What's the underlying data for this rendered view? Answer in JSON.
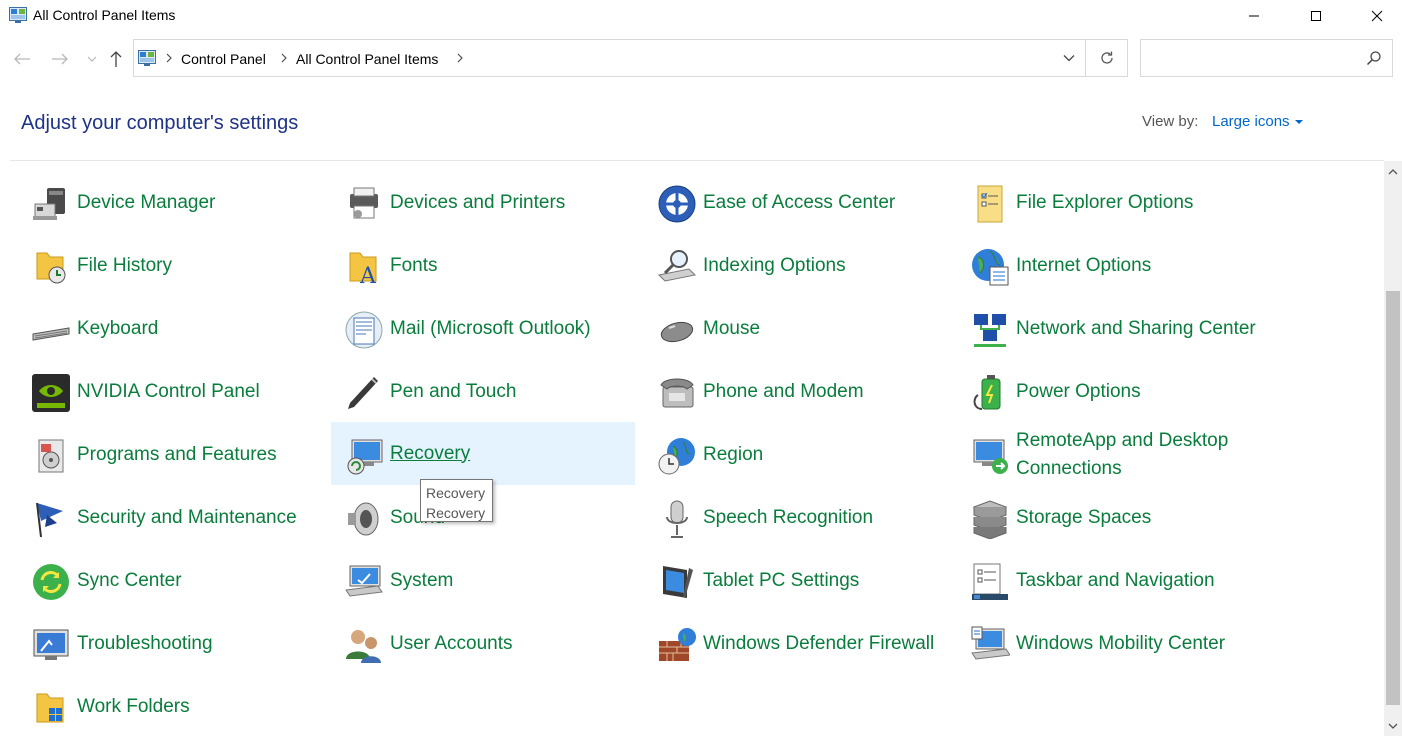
{
  "window": {
    "title": "All Control Panel Items",
    "icon": "control-panel-icon"
  },
  "address": {
    "breadcrumbs": [
      "Control Panel",
      "All Control Panel Items"
    ]
  },
  "search": {
    "value": "",
    "placeholder": ""
  },
  "header": {
    "heading": "Adjust your computer's settings",
    "view_by_label": "View by:",
    "view_by_value": "Large icons"
  },
  "items": [
    {
      "label": "Device Manager",
      "icon": "device-manager-icon"
    },
    {
      "label": "Devices and Printers",
      "icon": "devices-printers-icon"
    },
    {
      "label": "Ease of Access Center",
      "icon": "ease-of-access-icon"
    },
    {
      "label": "File Explorer Options",
      "icon": "file-explorer-options-icon"
    },
    {
      "label": "File History",
      "icon": "file-history-icon"
    },
    {
      "label": "Fonts",
      "icon": "fonts-icon"
    },
    {
      "label": "Indexing Options",
      "icon": "indexing-options-icon"
    },
    {
      "label": "Internet Options",
      "icon": "internet-options-icon"
    },
    {
      "label": "Keyboard",
      "icon": "keyboard-icon"
    },
    {
      "label": "Mail (Microsoft Outlook)",
      "icon": "mail-icon"
    },
    {
      "label": "Mouse",
      "icon": "mouse-icon"
    },
    {
      "label": "Network and Sharing Center",
      "icon": "network-sharing-icon"
    },
    {
      "label": "NVIDIA Control Panel",
      "icon": "nvidia-icon"
    },
    {
      "label": "Pen and Touch",
      "icon": "pen-touch-icon"
    },
    {
      "label": "Phone and Modem",
      "icon": "phone-modem-icon"
    },
    {
      "label": "Power Options",
      "icon": "power-options-icon"
    },
    {
      "label": "Programs and Features",
      "icon": "programs-features-icon"
    },
    {
      "label": "Recovery",
      "icon": "recovery-icon"
    },
    {
      "label": "Region",
      "icon": "region-icon"
    },
    {
      "label": "RemoteApp and Desktop Connections",
      "icon": "remoteapp-icon"
    },
    {
      "label": "Security and Maintenance",
      "icon": "security-maintenance-icon"
    },
    {
      "label": "Sound",
      "icon": "sound-icon"
    },
    {
      "label": "Speech Recognition",
      "icon": "speech-recognition-icon"
    },
    {
      "label": "Storage Spaces",
      "icon": "storage-spaces-icon"
    },
    {
      "label": "Sync Center",
      "icon": "sync-center-icon"
    },
    {
      "label": "System",
      "icon": "system-icon"
    },
    {
      "label": "Tablet PC Settings",
      "icon": "tablet-pc-icon"
    },
    {
      "label": "Taskbar and Navigation",
      "icon": "taskbar-navigation-icon"
    },
    {
      "label": "Troubleshooting",
      "icon": "troubleshooting-icon"
    },
    {
      "label": "User Accounts",
      "icon": "user-accounts-icon"
    },
    {
      "label": "Windows Defender Firewall",
      "icon": "firewall-icon"
    },
    {
      "label": "Windows Mobility Center",
      "icon": "mobility-center-icon"
    },
    {
      "label": "Work Folders",
      "icon": "work-folders-icon"
    }
  ],
  "hovered_item": "Recovery",
  "tooltip": {
    "line1": "Recovery",
    "line2": "Recovery"
  },
  "colors": {
    "item_text": "#097d3c",
    "heading": "#1e3287",
    "link": "#0066cc",
    "hover_bg": "#e5f3ff"
  }
}
